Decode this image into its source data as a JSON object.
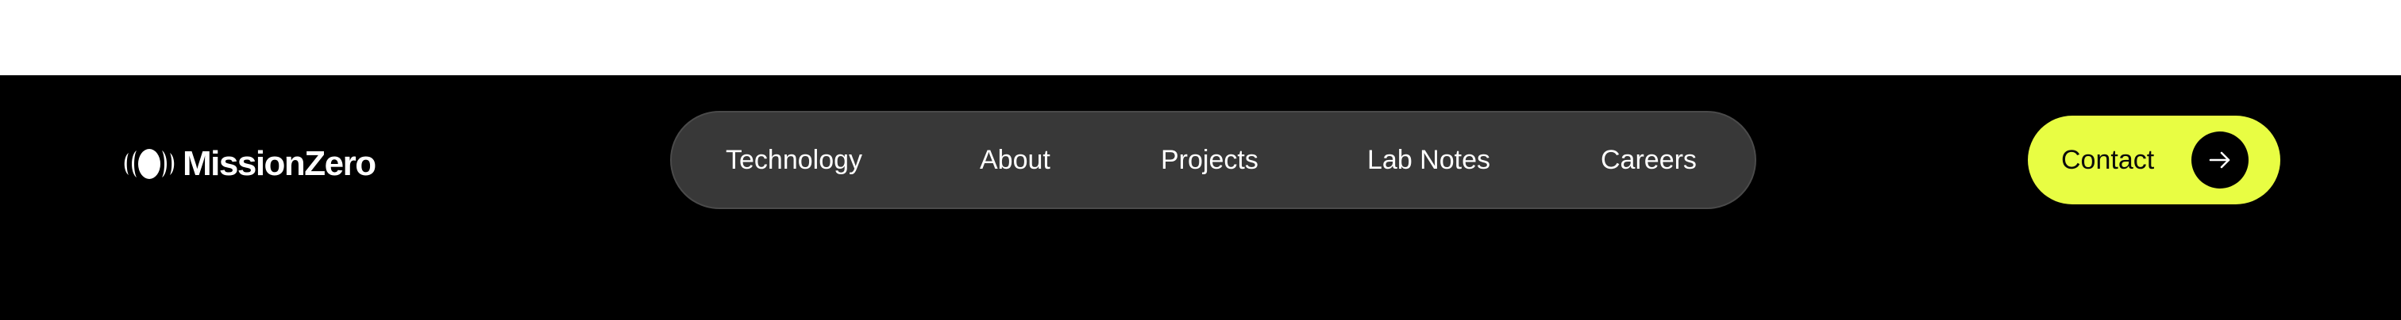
{
  "brand": {
    "name": "MissionZero",
    "logo_icon": "mission-zero-mark-icon"
  },
  "nav": {
    "items": [
      {
        "label": "Technology"
      },
      {
        "label": "About"
      },
      {
        "label": "Projects"
      },
      {
        "label": "Lab Notes"
      },
      {
        "label": "Careers"
      }
    ]
  },
  "cta": {
    "label": "Contact",
    "icon": "arrow-right-icon"
  },
  "colors": {
    "background": "#000000",
    "nav_pill": "#383838",
    "accent": "#e8fd43",
    "text": "#ffffff"
  }
}
